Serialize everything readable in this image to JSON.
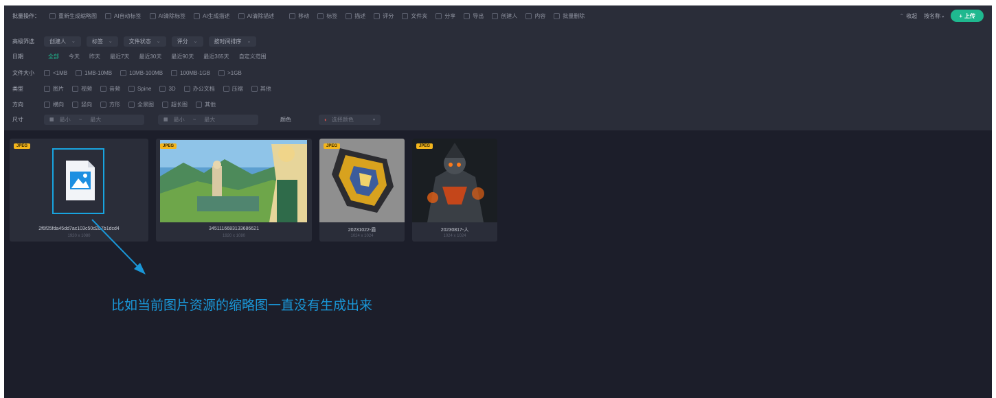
{
  "toolbar": {
    "title": "批量操作：",
    "actions": [
      {
        "label": "重新生成缩略图"
      },
      {
        "label": "AI自动标签"
      },
      {
        "label": "AI清除标签"
      },
      {
        "label": "AI生成描述"
      },
      {
        "label": "AI清除描述"
      }
    ],
    "checks": [
      {
        "label": "移动"
      },
      {
        "label": "标签"
      },
      {
        "label": "描述"
      },
      {
        "label": "评分"
      },
      {
        "label": "文件夹"
      },
      {
        "label": "分享"
      },
      {
        "label": "导出"
      },
      {
        "label": "创建人"
      },
      {
        "label": "内容"
      },
      {
        "label": "批量删除"
      }
    ],
    "right_link": "收起",
    "sort_label": "按名称",
    "upload_label": "上传"
  },
  "filters": {
    "search_label": "高级筛选",
    "dropdowns": [
      {
        "label": "创建人"
      },
      {
        "label": "标签"
      },
      {
        "label": "文件状态"
      },
      {
        "label": "评分"
      },
      {
        "label": "按时间排序"
      }
    ],
    "date": {
      "label": "日期",
      "options": [
        {
          "label": "全部",
          "active": true
        },
        {
          "label": "今天",
          "active": false
        },
        {
          "label": "昨天",
          "active": false
        },
        {
          "label": "最近7天",
          "active": false
        },
        {
          "label": "最近30天",
          "active": false
        },
        {
          "label": "最近90天",
          "active": false
        },
        {
          "label": "最近365天",
          "active": false
        },
        {
          "label": "自定义范围",
          "active": false
        }
      ]
    },
    "size": {
      "label": "文件大小",
      "options": [
        {
          "label": "<1MB"
        },
        {
          "label": "1MB-10MB"
        },
        {
          "label": "10MB-100MB"
        },
        {
          "label": "100MB-1GB"
        },
        {
          "label": ">1GB"
        }
      ]
    },
    "type": {
      "label": "类型",
      "options": [
        {
          "label": "图片"
        },
        {
          "label": "视频"
        },
        {
          "label": "音频"
        },
        {
          "label": "Spine"
        },
        {
          "label": "3D"
        },
        {
          "label": "办公文档"
        },
        {
          "label": "压缩"
        },
        {
          "label": "其他"
        }
      ]
    },
    "orientation": {
      "label": "方向",
      "options": [
        {
          "label": "横向"
        },
        {
          "label": "竖向"
        },
        {
          "label": "方形"
        },
        {
          "label": "全景图"
        },
        {
          "label": "超长图"
        },
        {
          "label": "其他"
        }
      ]
    },
    "dims": {
      "label": "尺寸",
      "width_min": "最小",
      "width_max": "最大",
      "height_min": "最小",
      "height_max": "最大",
      "color_label": "颜色",
      "color_value": "选择颜色"
    }
  },
  "cards": [
    {
      "badge": "JPEG",
      "name": "2f6f25fda45dd7ac103c50d2b7b1dcd4",
      "meta": "1920 x 1080"
    },
    {
      "badge": "JPEG",
      "name": "3451116683133686621",
      "meta": "1920 x 1080"
    },
    {
      "badge": "JPEG",
      "name": "20231022-盾",
      "meta": "1024 x 1024"
    },
    {
      "badge": "JPEG",
      "name": "20230817-人",
      "meta": "1024 x 1024"
    }
  ],
  "annotation": {
    "text": "比如当前图片资源的缩略图一直没有生成出来",
    "color": "#1a97d8"
  },
  "colors": {
    "accent": "#1fb88f",
    "badge": "#f3b51d",
    "background": "#1c1e2a"
  }
}
